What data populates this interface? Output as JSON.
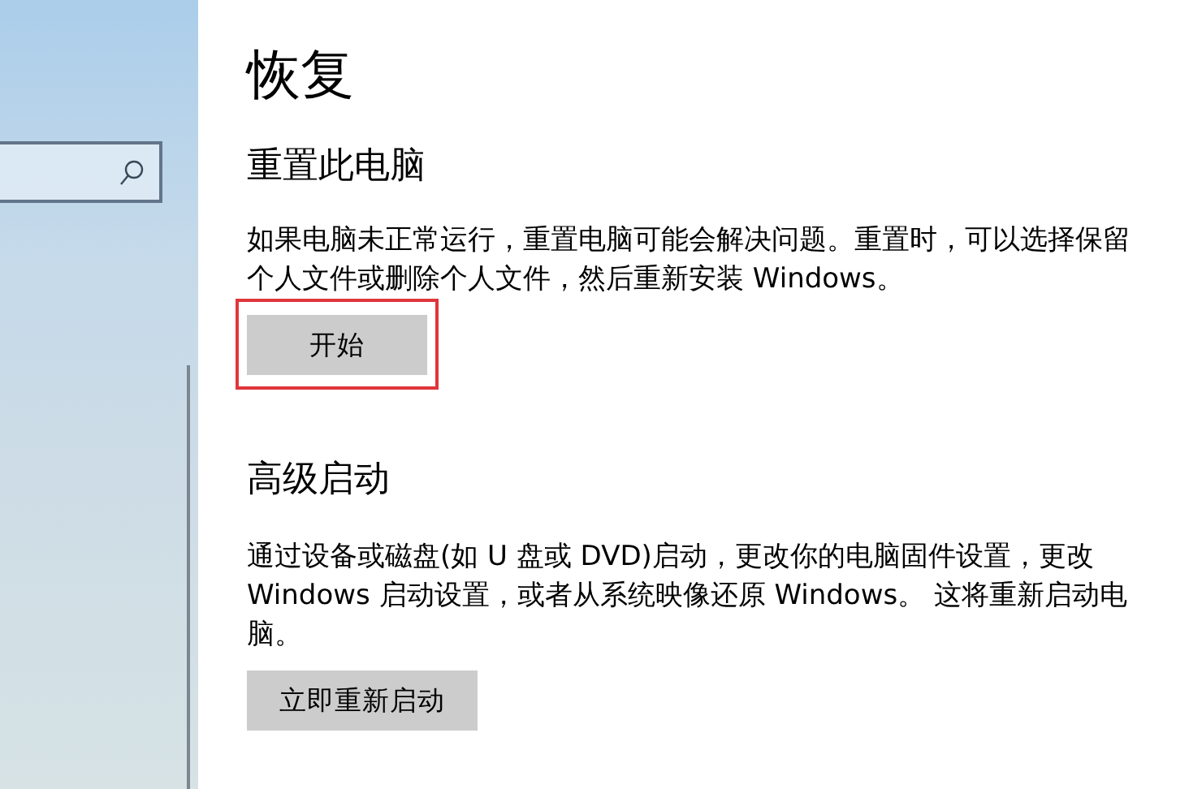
{
  "sidebar": {
    "search": {
      "kind": "search"
    }
  },
  "page": {
    "title": "恢复"
  },
  "sections": [
    {
      "heading": "重置此电脑",
      "description": "如果电脑未正常运行，重置电脑可能会解决问题。重置时，可以选择保留个人文件或删除个人文件，然后重新安装 Windows。",
      "button": {
        "label": "开始",
        "highlighted": true
      }
    },
    {
      "heading": "高级启动",
      "description": "通过设备或磁盘(如 U 盘或 DVD)启动，更改你的电脑固件设置，更改 Windows 启动设置，或者从系统映像还原 Windows。 这将重新启动电脑。",
      "button": {
        "label": "立即重新启动",
        "highlighted": false
      }
    }
  ]
}
